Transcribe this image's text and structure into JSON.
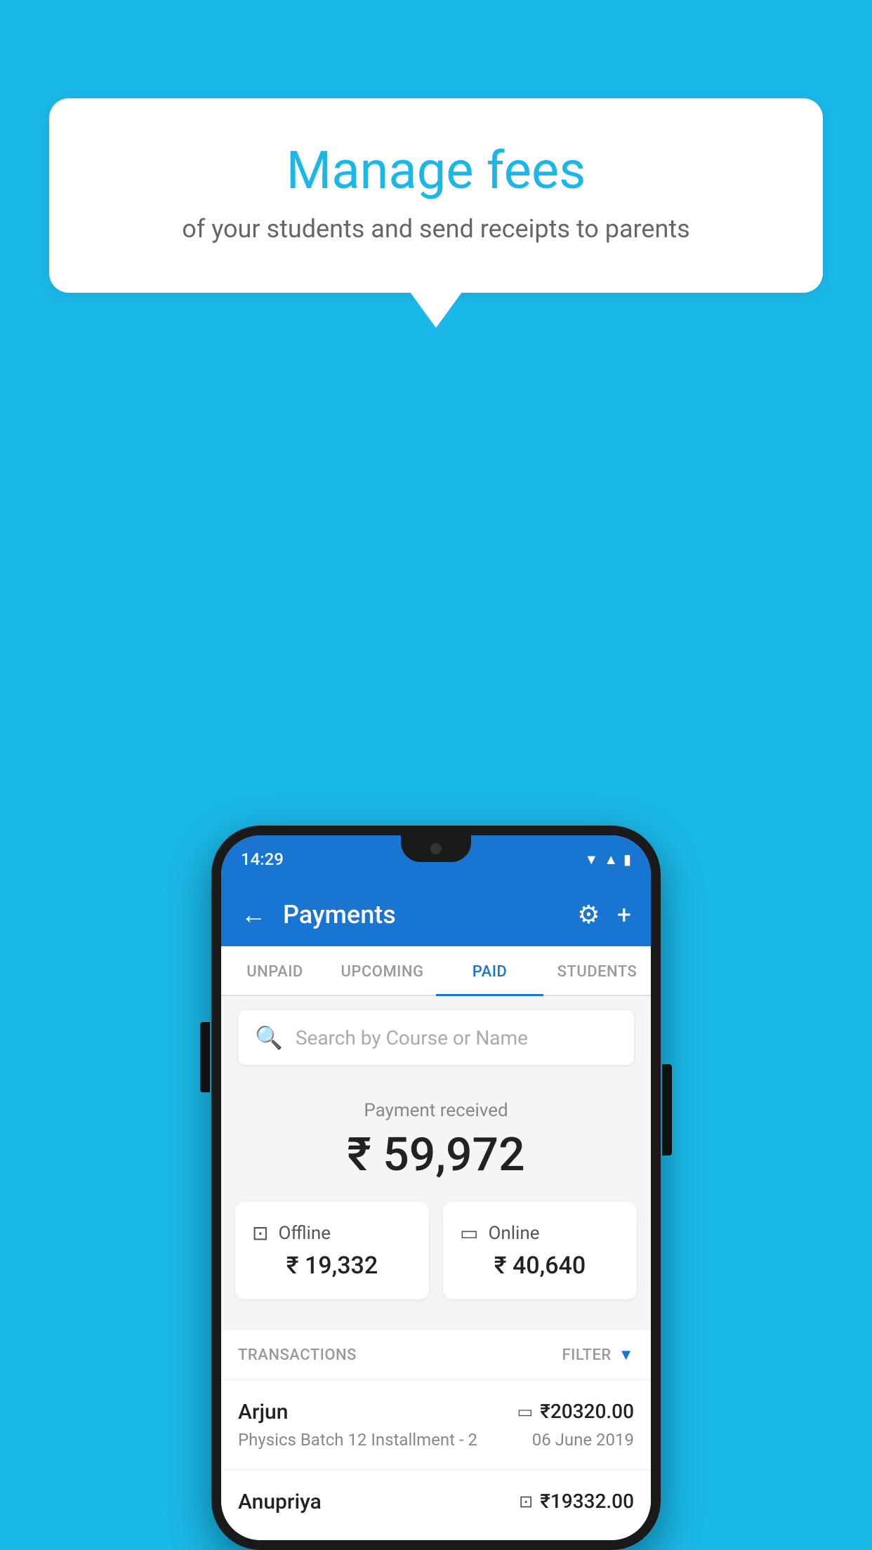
{
  "background_color": "#1ab8e8",
  "speech_bubble": {
    "title": "Manage fees",
    "subtitle": "of your students and send receipts to parents"
  },
  "status_bar": {
    "time": "14:29",
    "icons": [
      "wifi",
      "signal",
      "battery"
    ]
  },
  "app_bar": {
    "back_label": "←",
    "title": "Payments",
    "gear_icon": "⚙",
    "plus_icon": "+"
  },
  "tabs": [
    {
      "label": "UNPAID",
      "active": false
    },
    {
      "label": "UPCOMING",
      "active": false
    },
    {
      "label": "PAID",
      "active": true
    },
    {
      "label": "STUDENTS",
      "active": false
    }
  ],
  "search": {
    "placeholder": "Search by Course or Name",
    "search_icon": "🔍"
  },
  "payment_received": {
    "label": "Payment received",
    "amount": "₹ 59,972",
    "offline": {
      "type": "Offline",
      "amount": "₹ 19,332",
      "icon": "💳"
    },
    "online": {
      "type": "Online",
      "amount": "₹ 40,640",
      "icon": "💳"
    }
  },
  "transactions_section": {
    "label": "TRANSACTIONS",
    "filter_label": "FILTER",
    "rows": [
      {
        "name": "Arjun",
        "description": "Physics Batch 12 Installment - 2",
        "amount": "₹20320.00",
        "date": "06 June 2019",
        "payment_type": "online"
      },
      {
        "name": "Anupriya",
        "description": "",
        "amount": "₹19332.00",
        "date": "",
        "payment_type": "offline"
      }
    ]
  }
}
